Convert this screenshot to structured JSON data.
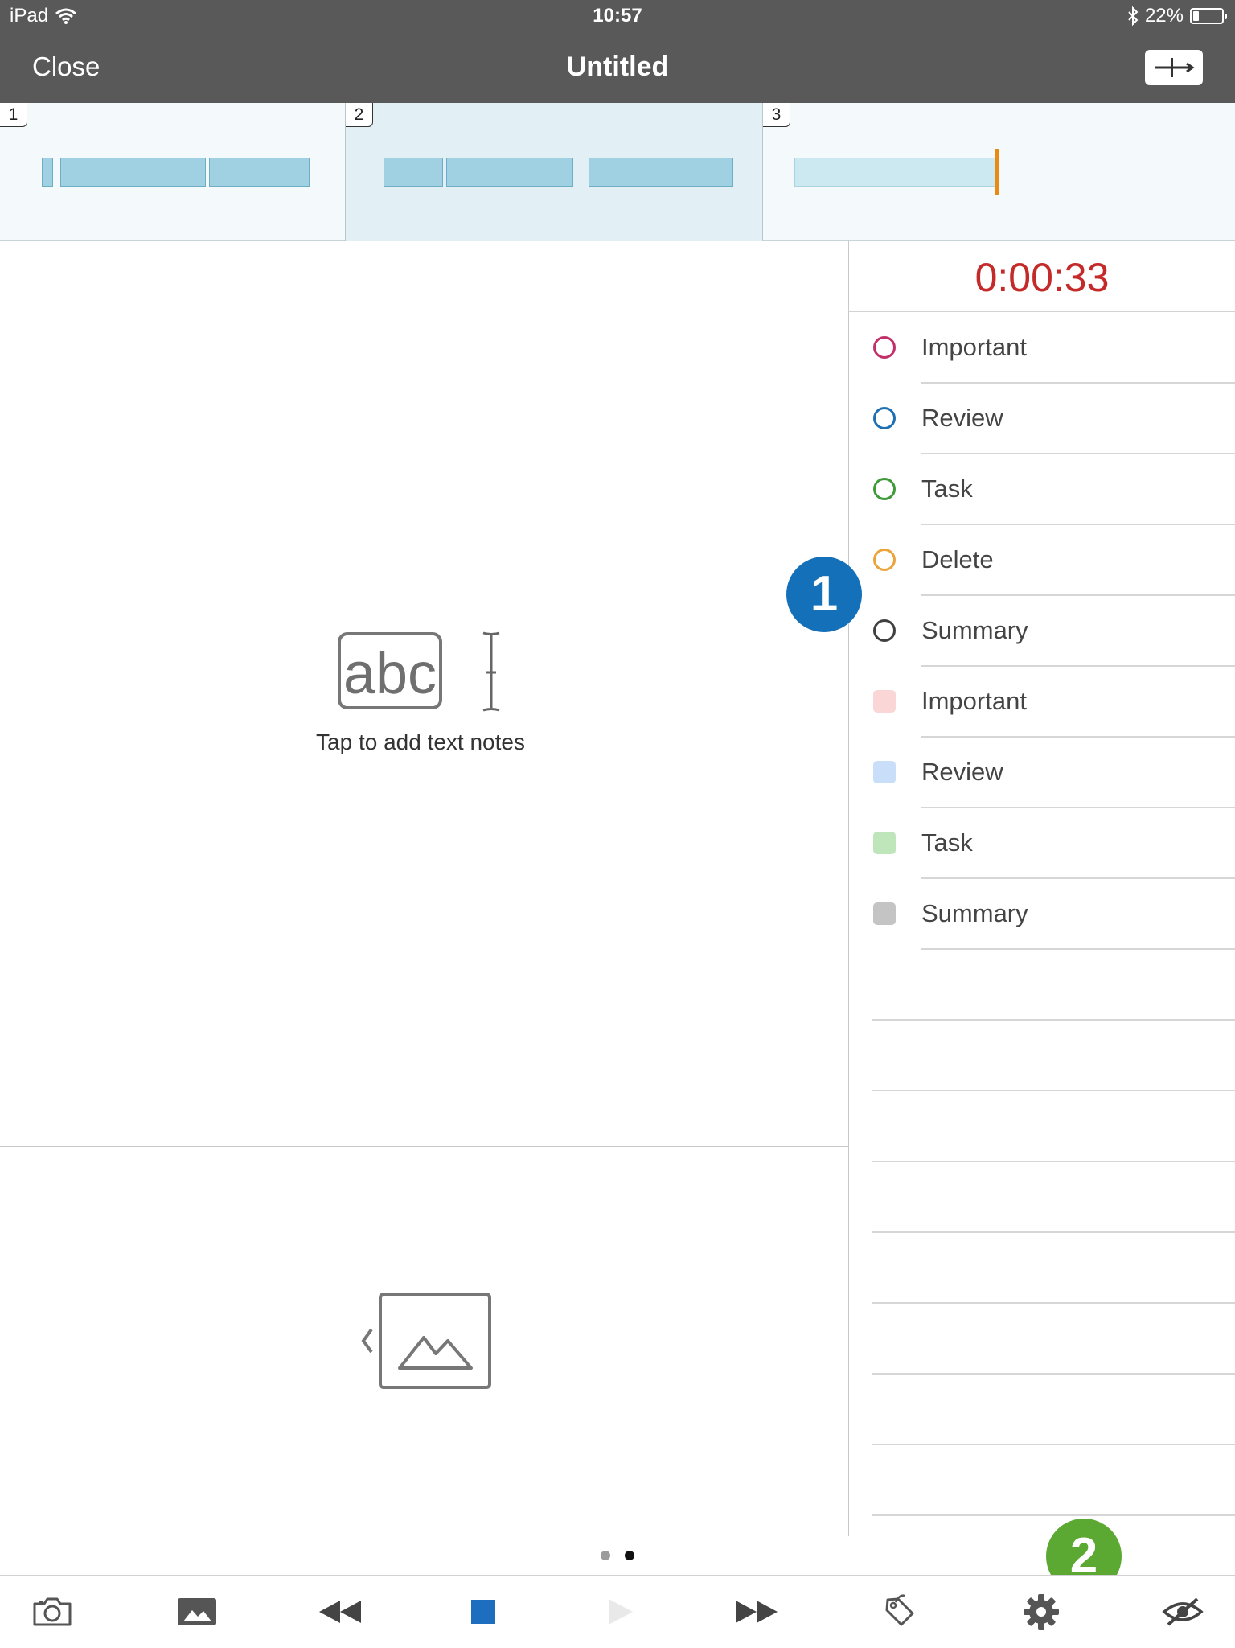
{
  "status_bar": {
    "device": "iPad",
    "time": "10:57",
    "battery": "22%",
    "battery_level": 0.22
  },
  "nav": {
    "close_label": "Close",
    "title": "Untitled",
    "right_button_icon": "split-icon"
  },
  "pages": [
    {
      "number": "1"
    },
    {
      "number": "2"
    },
    {
      "number": "3"
    }
  ],
  "notes": {
    "hint": "Tap to add text notes",
    "placeholder_text": "abc"
  },
  "panel": {
    "timer": "0:00:33",
    "tags": [
      {
        "label": "Important",
        "style": "circle",
        "color": "#c2306a"
      },
      {
        "label": "Review",
        "style": "circle",
        "color": "#1e6fb4"
      },
      {
        "label": "Task",
        "style": "circle",
        "color": "#3f9a3a"
      },
      {
        "label": "Delete",
        "style": "circle",
        "color": "#eba43b"
      },
      {
        "label": "Summary",
        "style": "circle",
        "color": "#404040"
      },
      {
        "label": "Important",
        "style": "square",
        "color": "#fbd6d6"
      },
      {
        "label": "Review",
        "style": "square",
        "color": "#c9def8"
      },
      {
        "label": "Task",
        "style": "square",
        "color": "#bfe5bb"
      },
      {
        "label": "Summary",
        "style": "square",
        "color": "#c4c4c4"
      }
    ]
  },
  "callouts": [
    {
      "label": "1",
      "color": "#1570ba"
    },
    {
      "label": "2",
      "color": "#5ba933"
    }
  ],
  "toolbar": {
    "icons": [
      "camera-icon",
      "photo-icon",
      "rewind-icon",
      "stop-icon",
      "play-icon",
      "fast-forward-icon",
      "tag-icon",
      "settings-icon",
      "hide-icon"
    ]
  },
  "page_indicator": {
    "count": 2,
    "current": 2
  }
}
